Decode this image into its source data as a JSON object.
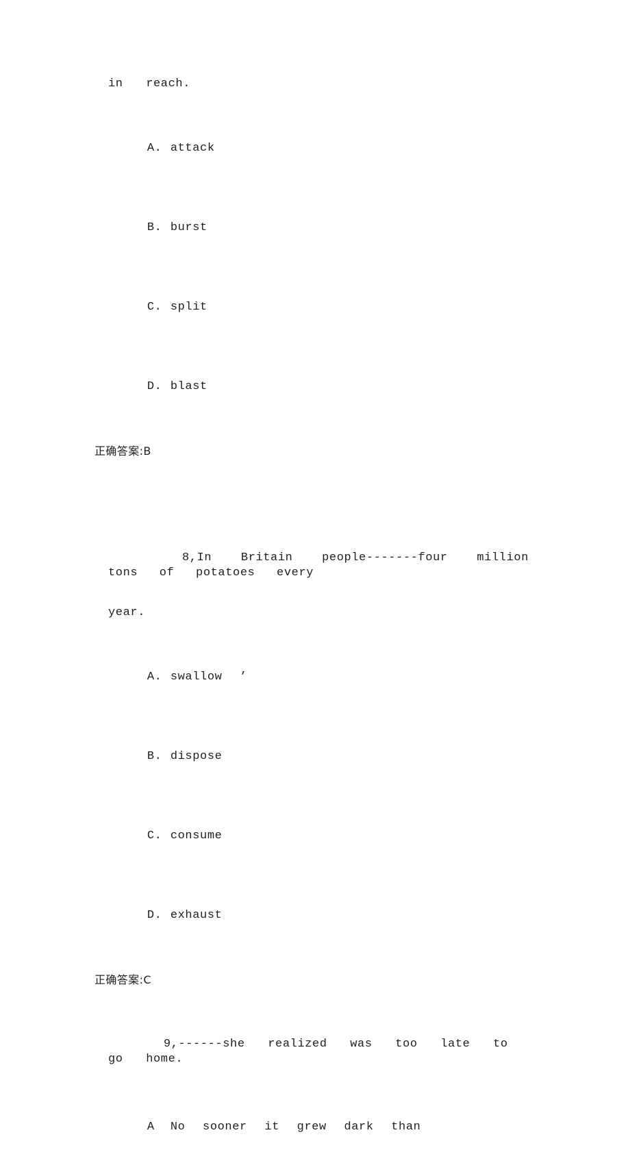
{
  "document": {
    "type": "exam-answer-sheet",
    "language": "en-CN",
    "text_color": "#1f1f1f",
    "background_color": "#ffffff"
  },
  "blocks": [
    {
      "id": "q7-tail",
      "stem_tail": "in  reach.",
      "options": [
        {
          "label": "A.",
          "text": "attack"
        },
        {
          "label": "B.",
          "text": "burst"
        },
        {
          "label": "C.",
          "text": "split"
        },
        {
          "label": "D.",
          "text": "blast"
        }
      ],
      "answer_line": "正确答案:B"
    },
    {
      "id": "q8",
      "number": "8,",
      "stem_line1": "In  Britain  people-------four  million  tons  of  potatoes  every",
      "stem_line2": "year.",
      "options": [
        {
          "label": "A.",
          "text": "swallow  ’"
        },
        {
          "label": "B.",
          "text": "dispose"
        },
        {
          "label": "C.",
          "text": "consume"
        },
        {
          "label": "D.",
          "text": "exhaust"
        }
      ],
      "answer_line": "正确答案:C"
    },
    {
      "id": "q9",
      "number": "9,",
      "stem_line1": "------she  realized  was  too  late  to  go  home.",
      "options": [
        {
          "label": "A",
          "text": "No  sooner  it  grew  dark  than"
        }
      ]
    }
  ]
}
